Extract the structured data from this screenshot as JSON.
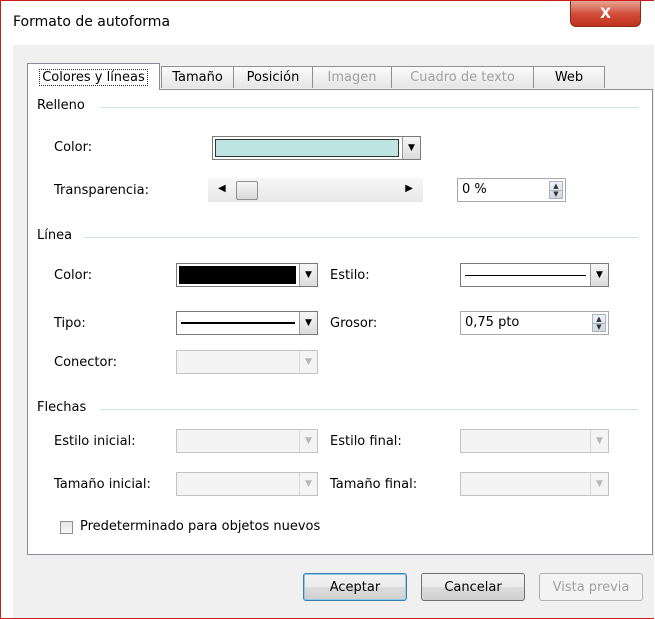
{
  "window": {
    "title": "Formato de autoforma",
    "close_glyph": "X"
  },
  "tabs": [
    {
      "label": "Colores y líneas",
      "state": "active"
    },
    {
      "label": "Tamaño",
      "state": "enabled"
    },
    {
      "label": "Posición",
      "state": "enabled"
    },
    {
      "label": "Imagen",
      "state": "disabled"
    },
    {
      "label": "Cuadro de texto",
      "state": "disabled"
    },
    {
      "label": "Web",
      "state": "enabled"
    }
  ],
  "fill": {
    "section": "Relleno",
    "color_label": "Color:",
    "color_value": "#bde3e3",
    "transparency_label": "Transparencia:",
    "transparency_value": "0 %"
  },
  "line": {
    "section": "Línea",
    "color_label": "Color:",
    "color_value": "#000000",
    "style_label": "Estilo:",
    "type_label": "Tipo:",
    "weight_label": "Grosor:",
    "weight_value": "0,75 pto",
    "connector_label": "Conector:"
  },
  "arrows": {
    "section": "Flechas",
    "start_style_label": "Estilo inicial:",
    "end_style_label": "Estilo final:",
    "start_size_label": "Tamaño inicial:",
    "end_size_label": "Tamaño final:"
  },
  "default_checkbox": {
    "label": "Predeterminado para objetos nuevos",
    "checked": false
  },
  "buttons": {
    "ok": "Aceptar",
    "cancel": "Cancelar",
    "preview": "Vista previa"
  }
}
